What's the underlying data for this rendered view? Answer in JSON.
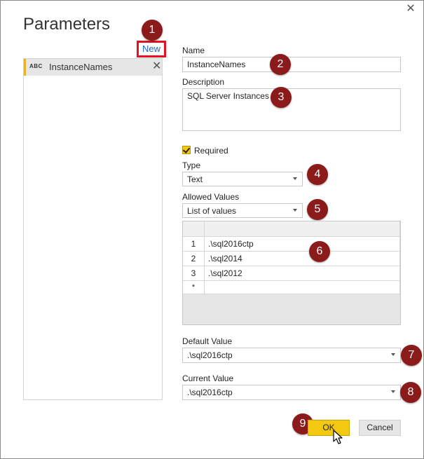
{
  "dialog": {
    "title": "Parameters",
    "new_link": "New",
    "close_icon": "close-icon"
  },
  "parameters": [
    {
      "type_badge": "ABC",
      "name": "InstanceNames"
    }
  ],
  "form": {
    "name_label": "Name",
    "name_value": "InstanceNames",
    "description_label": "Description",
    "description_value": "SQL Server Instances",
    "required_label": "Required",
    "required_checked": true,
    "type_label": "Type",
    "type_value": "Text",
    "allowed_values_label": "Allowed Values",
    "allowed_values_value": "List of values",
    "values_grid": {
      "rows": [
        {
          "index": "1",
          "value": ".\\sql2016ctp"
        },
        {
          "index": "2",
          "value": ".\\sql2014"
        },
        {
          "index": "3",
          "value": ".\\sql2012"
        }
      ],
      "new_row_marker": "*"
    },
    "default_value_label": "Default Value",
    "default_value": ".\\sql2016ctp",
    "current_value_label": "Current Value",
    "current_value": ".\\sql2016ctp"
  },
  "buttons": {
    "ok": "OK",
    "cancel": "Cancel"
  },
  "callouts": [
    "1",
    "2",
    "3",
    "4",
    "5",
    "6",
    "7",
    "8",
    "9"
  ],
  "colors": {
    "accent": "#f2c811",
    "callout": "#8b1a1a",
    "link": "#1f63c9",
    "highlight_border": "#e81123"
  }
}
